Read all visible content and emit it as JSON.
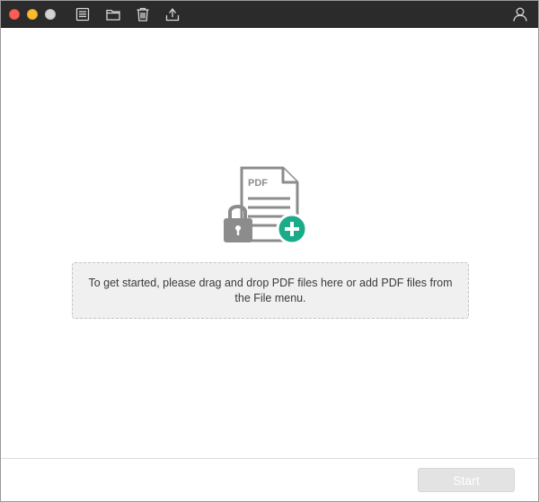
{
  "toolbar": {
    "icons": {
      "list": "list-icon",
      "folder": "folder-icon",
      "trash": "trash-icon",
      "export": "export-icon",
      "user": "user-icon"
    },
    "icon_color": "#d8d8d8"
  },
  "hero": {
    "doc_label": "PDF",
    "doc_color": "#8c8c8c",
    "lock_color": "#8c8c8c",
    "plus_color": "#1aab8a"
  },
  "dropzone": {
    "message": "To get started, please drag and drop PDF files here or add PDF files from the File menu."
  },
  "footer": {
    "start_label": "Start"
  },
  "colors": {
    "titlebar": "#2b2b2b",
    "close": "#fc5f57",
    "minimize": "#fdbc2e",
    "maximize": "#d3d3d3",
    "accent": "#1aab8a"
  }
}
